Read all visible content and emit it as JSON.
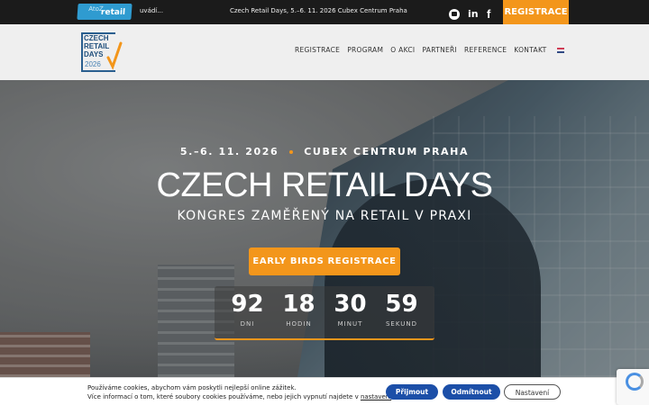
{
  "topbar": {
    "atoz_small": "AtoZ",
    "atoz_big": "retail",
    "uvadi": "uvádí...",
    "info": "Czech Retail Days, 5.–6. 11. 2026 Cubex Centrum Praha",
    "register_label": "REGISTRACE",
    "social": [
      "youtube-icon",
      "linkedin-icon",
      "facebook-icon"
    ],
    "linkedin_glyph": "in",
    "facebook_glyph": "f"
  },
  "logo": {
    "line1": "CZECH",
    "line2": "RETAIL",
    "line3": "DAYS",
    "year": "2026"
  },
  "nav": {
    "items": [
      "REGISTRACE",
      "PROGRAM",
      "O AKCI",
      "PARTNEŘI",
      "REFERENCE",
      "KONTAKT"
    ]
  },
  "hero": {
    "dates": "5.–6. 11. 2026",
    "venue": "CUBEX CENTRUM PRAHA",
    "title": "CZECH RETAIL DAYS",
    "subtitle": "KONGRES ZAMĚŘENÝ NA RETAIL V PRAXI",
    "button": "EARLY BIRDS REGISTRACE"
  },
  "countdown": [
    {
      "value": "92",
      "label": "DNI"
    },
    {
      "value": "18",
      "label": "HODIN"
    },
    {
      "value": "30",
      "label": "MINUT"
    },
    {
      "value": "59",
      "label": "SEKUND"
    }
  ],
  "cookies": {
    "line1": "Používáme cookies, abychom vám poskytli nejlepší online zážitek.",
    "line2_pre": "Více informací o tom, které soubory cookies používáme, nebo jejich vypnutí najdete v ",
    "line2_link": "nastavení",
    "line2_post": ".",
    "accept": "Přijmout",
    "reject": "Odmítnout",
    "settings": "Nastavení"
  },
  "colors": {
    "accent": "#f3961b",
    "cookie_button": "#1c4fa8",
    "logo_blue": "#1f4f7c"
  }
}
